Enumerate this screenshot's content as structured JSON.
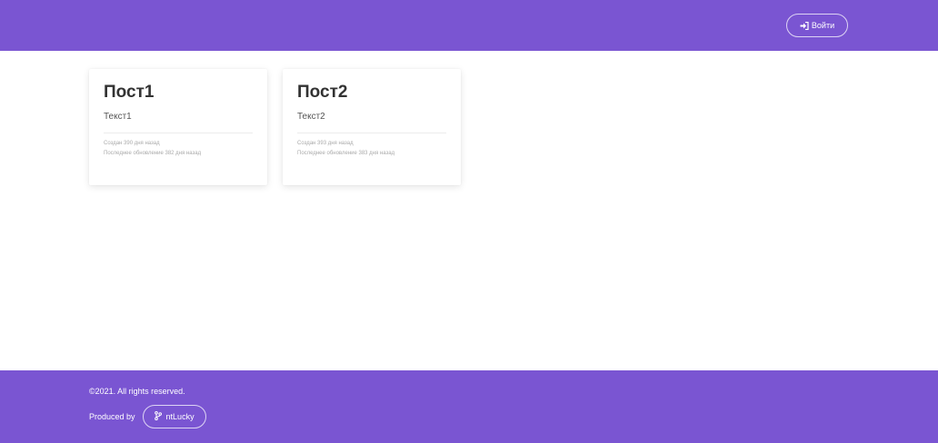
{
  "colors": {
    "brand": "#7a55d2",
    "card_title": "#333333",
    "meta_text": "#aaaaaa"
  },
  "header": {
    "login_label": "Войти",
    "login_icon": "sign-in-icon"
  },
  "posts": [
    {
      "title": "Пост1",
      "text": "Текст1",
      "created": "Создан 390 дня назад",
      "updated": "Последнее обновление 382 дня назад"
    },
    {
      "title": "Пост2",
      "text": "Текст2",
      "created": "Создан 393 дня назад",
      "updated": "Последнее обновление 383 дня назад"
    }
  ],
  "footer": {
    "copyright": "©2021. All rights reserved.",
    "produced_by": "Produced by",
    "author": "ntLucky",
    "author_icon": "git-branch-icon"
  }
}
